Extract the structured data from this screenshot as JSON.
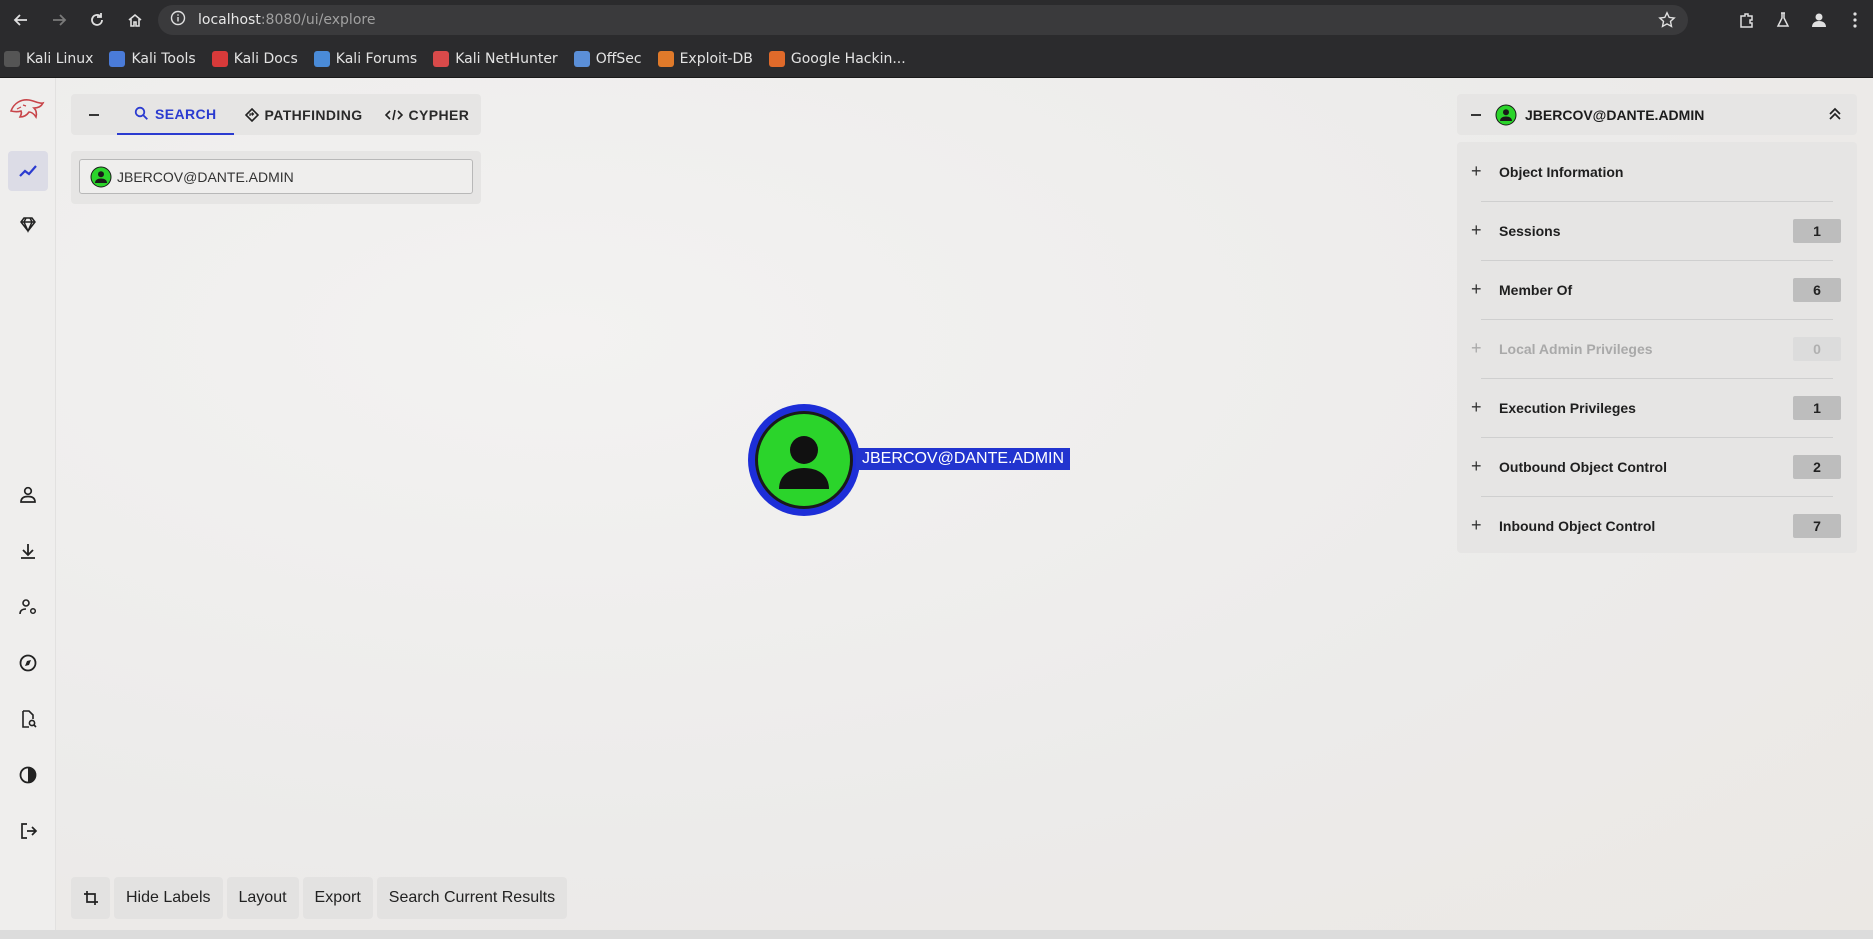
{
  "browser": {
    "url_host": "localhost",
    "url_path": ":8080/ui/explore",
    "bookmarks": [
      {
        "label": "Kali Linux",
        "color": "#ffffff"
      },
      {
        "label": "Kali Tools",
        "color": "#4a7bd8"
      },
      {
        "label": "Kali Docs",
        "color": "#d83a3a"
      },
      {
        "label": "Kali Forums",
        "color": "#4a8bd8"
      },
      {
        "label": "Kali NetHunter",
        "color": "#d84a4a"
      },
      {
        "label": "OffSec",
        "color": "#5b8fd8"
      },
      {
        "label": "Exploit-DB",
        "color": "#e07a2a"
      },
      {
        "label": "Google Hackin...",
        "color": "#e06a2a"
      }
    ]
  },
  "explore": {
    "tabs": {
      "search": "SEARCH",
      "pathfinding": "PATHFINDING",
      "cypher": "CYPHER"
    },
    "search_value": "JBERCOV@DANTE.ADMIN"
  },
  "graph": {
    "node_label": "JBERCOV@DANTE.ADMIN",
    "node_color": "#2bd42b",
    "selection_color": "#2234cf"
  },
  "bottom_buttons": {
    "hide_labels": "Hide Labels",
    "layout": "Layout",
    "export": "Export",
    "search_results": "Search Current Results"
  },
  "entity_panel": {
    "title": "JBERCOV@DANTE.ADMIN",
    "sections": [
      {
        "label": "Object Information",
        "count": ""
      },
      {
        "label": "Sessions",
        "count": "1"
      },
      {
        "label": "Member Of",
        "count": "6"
      },
      {
        "label": "Local Admin Privileges",
        "count": "0"
      },
      {
        "label": "Execution Privileges",
        "count": "1"
      },
      {
        "label": "Outbound Object Control",
        "count": "2"
      },
      {
        "label": "Inbound Object Control",
        "count": "7"
      }
    ]
  },
  "colors": {
    "accent": "#2b3bd0",
    "user_node": "#2bd42b"
  }
}
